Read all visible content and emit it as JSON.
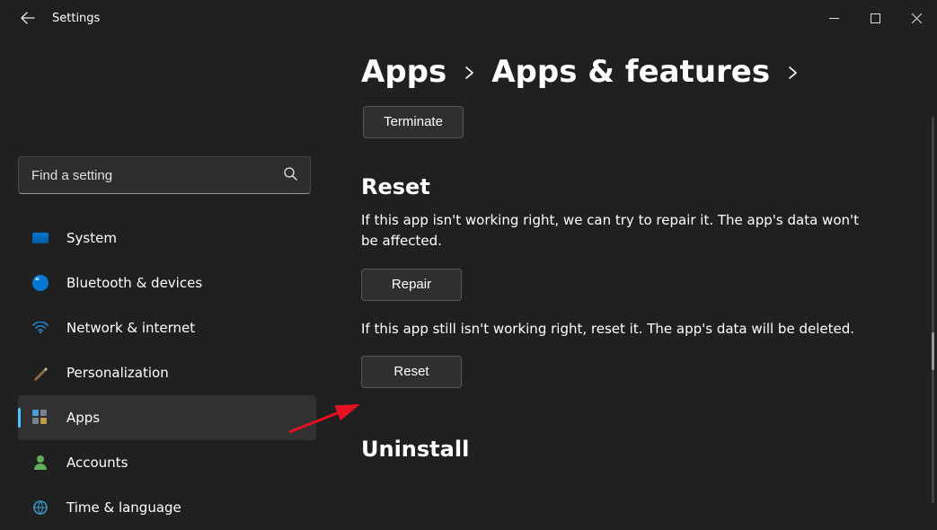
{
  "window": {
    "title": "Settings"
  },
  "search": {
    "placeholder": "Find a setting"
  },
  "sidebar": {
    "items": [
      {
        "label": "System"
      },
      {
        "label": "Bluetooth & devices"
      },
      {
        "label": "Network & internet"
      },
      {
        "label": "Personalization"
      },
      {
        "label": "Apps",
        "active": true
      },
      {
        "label": "Accounts"
      },
      {
        "label": "Time & language"
      }
    ]
  },
  "breadcrumb": {
    "first": "Apps",
    "second": "Apps & features"
  },
  "content": {
    "terminate_label": "Terminate",
    "reset": {
      "heading": "Reset",
      "repair_desc": "If this app isn't working right, we can try to repair it. The app's data won't be affected.",
      "repair_button": "Repair",
      "reset_desc": "If this app still isn't working right, reset it. The app's data will be deleted.",
      "reset_button": "Reset"
    },
    "uninstall": {
      "heading": "Uninstall"
    }
  }
}
